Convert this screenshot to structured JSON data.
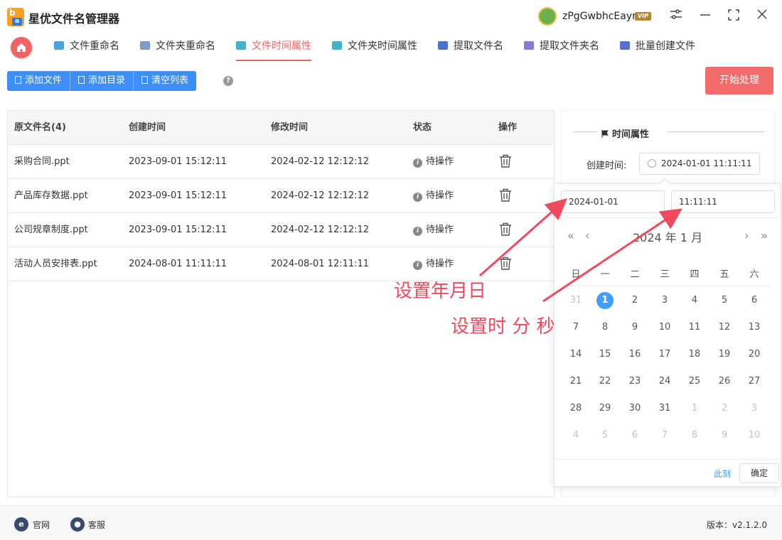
{
  "app": {
    "title": "星优文件名管理器",
    "username": "zPgGwbhcEayr",
    "vip": "VIP"
  },
  "nav": {
    "tabs": [
      {
        "label": "文件重命名",
        "color": "#4aa3df"
      },
      {
        "label": "文件夹重命名",
        "color": "#7a9cc6"
      },
      {
        "label": "文件时间属性",
        "color": "#3fb3c8"
      },
      {
        "label": "文件夹时间属性",
        "color": "#3fb3c8"
      },
      {
        "label": "提取文件名",
        "color": "#4a74c9"
      },
      {
        "label": "提取文件夹名",
        "color": "#8a7ad6"
      },
      {
        "label": "批量创建文件",
        "color": "#5a6fd1"
      }
    ],
    "active_index": 2
  },
  "toolbar": {
    "add_file": "添加文件",
    "add_dir": "添加目录",
    "clear_list": "清空列表",
    "help": "?",
    "start": "开始处理"
  },
  "table": {
    "headers": [
      "原文件名(4)",
      "创建时间",
      "修改时间",
      "状态",
      "操作"
    ],
    "rows": [
      {
        "name": "采购合同.ppt",
        "created": "2023-09-01 15:12:11",
        "modified": "2024-02-12 12:12:12",
        "status": "待操作"
      },
      {
        "name": "产品库存数据.ppt",
        "created": "2023-09-01 15:12:11",
        "modified": "2024-02-12 12:12:12",
        "status": "待操作"
      },
      {
        "name": "公司规章制度.ppt",
        "created": "2023-09-01 15:12:11",
        "modified": "2024-02-12 12:12:12",
        "status": "待操作"
      },
      {
        "name": "活动人员安排表.ppt",
        "created": "2024-08-01 11:11:11",
        "modified": "2024-08-01 12:11:11",
        "status": "待操作"
      }
    ]
  },
  "side": {
    "title": "时间属性",
    "created_label": "创建时间:",
    "created_value": "2024-01-01 11:11:11"
  },
  "picker": {
    "date_value": "2024-01-01",
    "time_value": "11:11:11",
    "header": "2024 年  1 月",
    "weekdays": [
      "日",
      "一",
      "二",
      "三",
      "四",
      "五",
      "六"
    ],
    "days": [
      [
        "31",
        "1",
        "2",
        "3",
        "4",
        "5",
        "6"
      ],
      [
        "7",
        "8",
        "9",
        "10",
        "11",
        "12",
        "13"
      ],
      [
        "14",
        "15",
        "16",
        "17",
        "18",
        "19",
        "20"
      ],
      [
        "21",
        "22",
        "23",
        "24",
        "25",
        "26",
        "27"
      ],
      [
        "28",
        "29",
        "30",
        "31",
        "1",
        "2",
        "3"
      ],
      [
        "4",
        "5",
        "6",
        "7",
        "8",
        "9",
        "10"
      ]
    ],
    "selected_day": "1",
    "now_label": "此刻",
    "ok_label": "确定"
  },
  "annotations": {
    "date": "设置年月日",
    "time": "设置时 分 秒",
    "color": "#f04a5e"
  },
  "footer": {
    "website": "官网",
    "support": "客服",
    "version": "版本：v2.1.2.0"
  }
}
